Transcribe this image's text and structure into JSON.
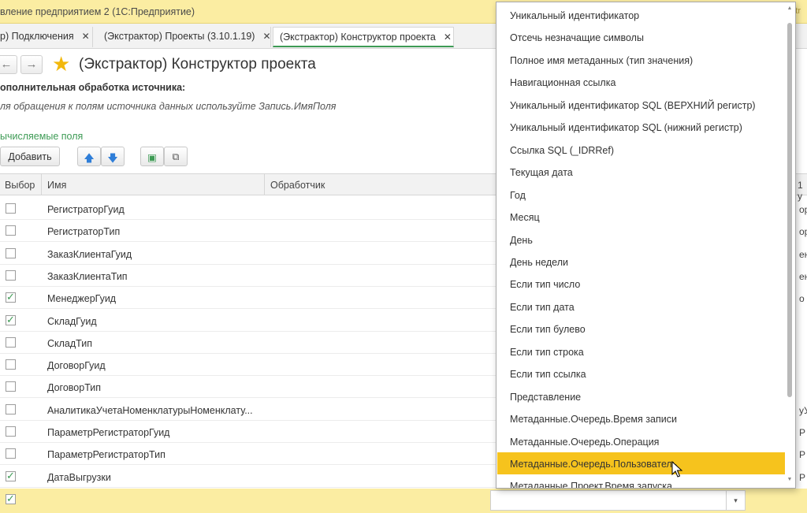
{
  "app": {
    "title": "вление предприятием 2  (1С:Предприятие)",
    "title_right": "...tr"
  },
  "tabs": [
    {
      "label": "р) Подключения",
      "close": "✕"
    },
    {
      "label": "(Экстрактор) Проекты (3.10.1.19)",
      "close": "✕"
    },
    {
      "label": "(Экстрактор) Конструктор проекта",
      "close": "✕"
    }
  ],
  "header": {
    "back": "←",
    "forward": "→",
    "star": "★",
    "title": "(Экстрактор) Конструктор проекта"
  },
  "form": {
    "section_label": "ополнительная обработка источника:",
    "hint": "ля обращения к полям источника данных используйте Запись.ИмяПоля",
    "group_link": "ычисляемые поля"
  },
  "toolbar": {
    "add_label": "Добавить",
    "up": "🡅",
    "down": "🡇",
    "select_all": "▣",
    "copy": "⧉"
  },
  "table": {
    "columns": [
      "Выбор",
      "Имя",
      "Обработчик"
    ],
    "rows": [
      {
        "checked": false,
        "name": "РегистраторГуид",
        "right": "ор"
      },
      {
        "checked": false,
        "name": "РегистраторТип",
        "right": "ор"
      },
      {
        "checked": false,
        "name": "ЗаказКлиентаГуид",
        "right": "ен"
      },
      {
        "checked": false,
        "name": "ЗаказКлиентаТип",
        "right": "ен"
      },
      {
        "checked": true,
        "name": "МенеджерГуид",
        "right": "о"
      },
      {
        "checked": true,
        "name": "СкладГуид",
        "right": ""
      },
      {
        "checked": false,
        "name": "СкладТип",
        "right": ""
      },
      {
        "checked": false,
        "name": "ДоговорГуид",
        "right": ""
      },
      {
        "checked": false,
        "name": "ДоговорТип",
        "right": ""
      },
      {
        "checked": false,
        "name": "АналитикаУчетаНоменклатурыНоменклату...",
        "right": "уУ"
      },
      {
        "checked": false,
        "name": "ПараметрРегистраторГуид",
        "right": "Р"
      },
      {
        "checked": false,
        "name": "ПараметрРегистраторТип",
        "right": "Р"
      },
      {
        "checked": true,
        "name": "ДатаВыгрузки",
        "right": "Р"
      }
    ],
    "right_header": "1 у"
  },
  "editing_row": {
    "checked": true,
    "dropdown_arrow": "▾"
  },
  "dropdown": {
    "items": [
      "Уникальный идентификатор",
      "Отсечь незначащие символы",
      "Полное имя метаданных (тип значения)",
      "Навигационная ссылка",
      "Уникальный идентификатор SQL (ВЕРХНИЙ регистр)",
      "Уникальный идентификатор SQL (нижний регистр)",
      "Ссылка SQL (_IDRRef)",
      "Текущая дата",
      "Год",
      "Месяц",
      "День",
      "День недели",
      "Если тип число",
      "Если тип дата",
      "Если тип булево",
      "Если тип строка",
      "Если тип ссылка",
      "Представление",
      "Метаданные.Очередь.Время записи",
      "Метаданные.Очередь.Операция",
      "Метаданные.Очередь.Пользователь",
      "Метаданные.Проект.Время запуска"
    ],
    "highlighted_index": 20,
    "scroll_up": "▲",
    "scroll_down": "▼"
  },
  "colors": {
    "accent_green": "#3e9b55",
    "highlight_yellow": "#f6c31d",
    "titlebar_yellow": "#fbeda2",
    "star": "#f2b80d"
  }
}
